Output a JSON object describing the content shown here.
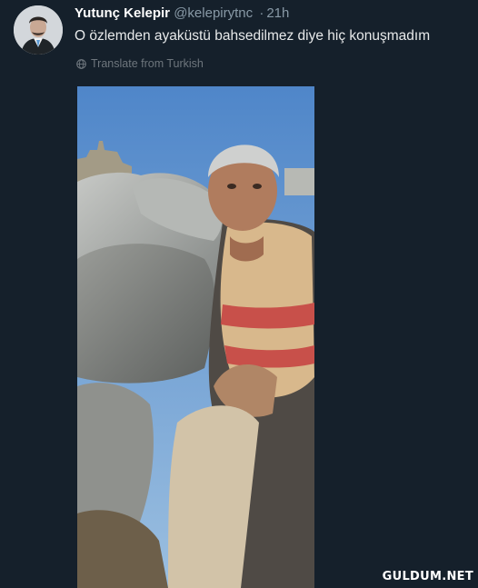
{
  "tweet": {
    "author_name": "Yutunç Kelepir",
    "handle": "@kelepirytnc",
    "separator": "·",
    "time": "21h",
    "text": "O özlemden ayaküstü bahsedilmez diye hiç konuşmadım",
    "translate_label": "Translate from Turkish"
  },
  "watermark": "GULDUM.NET",
  "colors": {
    "background": "#15202b",
    "name": "#ffffff",
    "secondary_text": "#8899a6"
  },
  "icons": [
    "globe-icon"
  ]
}
